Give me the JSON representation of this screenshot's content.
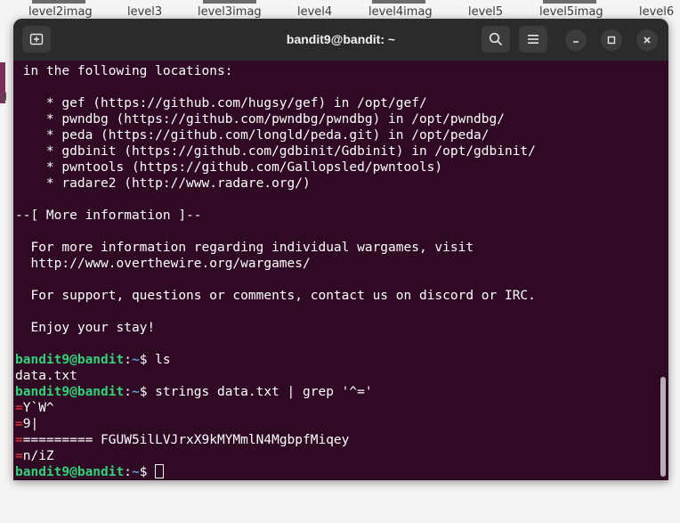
{
  "desktop": {
    "icons": [
      "level2imag",
      "level3",
      "level3imag",
      "level4",
      "level4imag",
      "level5",
      "level5imag",
      "level6"
    ],
    "partial_letter": "g"
  },
  "window": {
    "title": "bandit9@bandit: ~"
  },
  "icons": {
    "new_tab": "new-tab-icon",
    "search": "search-icon",
    "menu": "hamburger-menu-icon",
    "minimize": "minimize-icon",
    "maximize": "maximize-icon",
    "close": "close-icon"
  },
  "colors": {
    "terminal_bg": "#300a24",
    "prompt_user": "#33d17a",
    "prompt_path": "#5e9cd6",
    "grep_match": "#ff3b3b"
  },
  "terminal": {
    "motd": [
      " in the following locations:",
      "",
      "    * gef (https://github.com/hugsy/gef) in /opt/gef/",
      "    * pwndbg (https://github.com/pwndbg/pwndbg) in /opt/pwndbg/",
      "    * peda (https://github.com/longld/peda.git) in /opt/peda/",
      "    * gdbinit (https://github.com/gdbinit/Gdbinit) in /opt/gdbinit/",
      "    * pwntools (https://github.com/Gallopsled/pwntools)",
      "    * radare2 (http://www.radare.org/)",
      "",
      "--[ More information ]--",
      "",
      "  For more information regarding individual wargames, visit",
      "  http://www.overthewire.org/wargames/",
      "",
      "  For support, questions or comments, contact us on discord or IRC.",
      "",
      "  Enjoy your stay!",
      ""
    ],
    "prompt_user": "bandit9@bandit",
    "prompt_sep": ":",
    "prompt_path": "~",
    "prompt_symbol": "$ ",
    "cmd1": "ls",
    "out1": "data.txt",
    "cmd2": "strings data.txt | grep '^='",
    "grep_results": [
      {
        "match": "=",
        "rest": "Y`W^"
      },
      {
        "match": "=",
        "rest": "9|"
      },
      {
        "match": "=",
        "rest": "========= FGUW5ilLVJrxX9kMYMmlN4MgbpfMiqey"
      },
      {
        "match": "=",
        "rest": "n/iZ"
      }
    ]
  }
}
